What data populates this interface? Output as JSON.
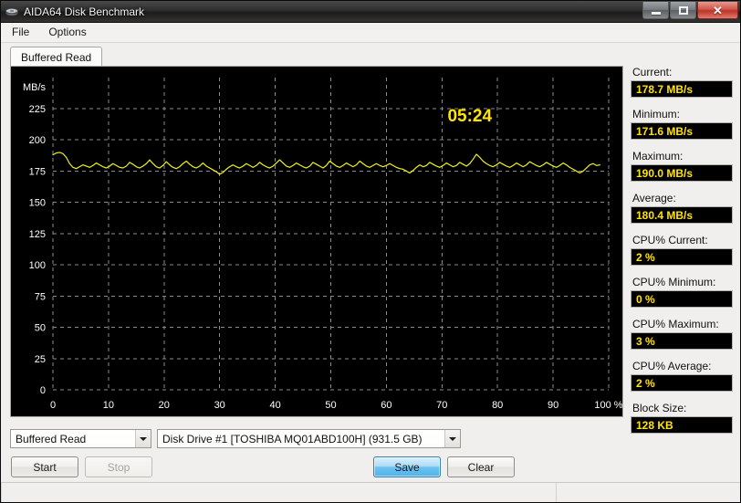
{
  "window": {
    "title": "AIDA64 Disk Benchmark",
    "icon": "disk-drive-icon",
    "minimize_label": "",
    "maximize_label": "",
    "close_label": "✕"
  },
  "menu": {
    "items": [
      {
        "label": "File"
      },
      {
        "label": "Options"
      }
    ]
  },
  "tabs": [
    {
      "label": "Buffered Read",
      "active": true
    }
  ],
  "chart_data": {
    "type": "line",
    "title": "",
    "xlabel": "%",
    "ylabel": "MB/s",
    "xlim": [
      0,
      100
    ],
    "ylim": [
      0,
      225
    ],
    "grid": true,
    "legend": "none",
    "xticks": [
      "0",
      "10",
      "20",
      "30",
      "40",
      "50",
      "60",
      "70",
      "80",
      "90",
      "100 %"
    ],
    "xtick_values": [
      0,
      10,
      20,
      30,
      40,
      50,
      60,
      70,
      80,
      90,
      100
    ],
    "yticks": [
      "0",
      "25",
      "50",
      "75",
      "100",
      "125",
      "150",
      "175",
      "200",
      "225"
    ],
    "ytick_values": [
      0,
      25,
      50,
      75,
      100,
      125,
      150,
      175,
      200,
      225
    ],
    "y_axis_caption": "MB/s",
    "series_color": "#f2f211",
    "timer_label": "05:24",
    "timer_color": "#ffe400",
    "background": "#000000",
    "gridline_color": "#8c8c8c",
    "series": [
      {
        "name": "Buffered Read",
        "x": [
          0.0,
          0.6,
          1.2,
          1.8,
          2.4,
          3.0,
          3.6,
          4.2,
          4.8,
          5.4,
          6.0,
          6.6,
          7.2,
          7.8,
          8.4,
          9.0,
          9.6,
          10.2,
          10.8,
          11.4,
          12.0,
          12.6,
          13.2,
          13.8,
          14.4,
          15.0,
          15.6,
          16.2,
          16.8,
          17.4,
          18.0,
          18.6,
          19.2,
          19.8,
          20.4,
          21.0,
          21.6,
          22.2,
          22.8,
          23.4,
          24.0,
          24.6,
          25.2,
          25.8,
          26.4,
          27.0,
          27.6,
          28.2,
          28.8,
          29.4,
          30.0,
          30.6,
          31.2,
          31.8,
          32.4,
          33.0,
          33.6,
          34.2,
          34.8,
          35.4,
          36.0,
          36.6,
          37.2,
          37.8,
          38.4,
          39.0,
          39.6,
          40.2,
          40.8,
          41.4,
          42.0,
          42.6,
          43.2,
          43.8,
          44.4,
          45.0,
          45.6,
          46.2,
          46.8,
          47.4,
          48.0,
          48.6,
          49.2,
          49.8,
          50.4,
          51.0,
          51.6,
          52.2,
          52.8,
          53.4,
          54.0,
          54.6,
          55.2,
          55.8,
          56.4,
          57.0,
          57.6,
          58.2,
          58.8,
          59.4,
          60.0,
          60.6,
          61.2,
          61.8,
          62.4,
          63.0,
          63.6,
          64.2,
          64.8,
          65.4,
          66.0,
          66.6,
          67.2,
          67.8,
          68.4,
          69.0,
          69.6,
          70.2,
          70.8,
          71.4,
          72.0,
          72.6,
          73.2,
          73.8,
          74.4,
          75.0,
          75.6,
          76.2,
          76.8,
          77.4,
          78.0,
          78.6,
          79.2,
          79.8,
          80.4,
          81.0,
          81.6,
          82.2,
          82.8,
          83.4,
          84.0,
          84.6,
          85.2,
          85.8,
          86.4,
          87.0,
          87.6,
          88.2,
          88.8,
          89.4,
          90.0,
          90.6,
          91.2,
          91.8,
          92.4,
          93.0,
          93.6,
          94.2,
          94.8,
          95.4,
          96.0,
          96.6,
          97.2,
          97.8,
          98.4,
          99.0,
          99.6,
          100.0
        ],
        "y": [
          188.0,
          189.5,
          190.0,
          189.0,
          186.0,
          181.0,
          178.0,
          177.0,
          178.5,
          180.0,
          179.0,
          178.0,
          179.5,
          181.5,
          180.0,
          178.5,
          177.5,
          179.0,
          181.0,
          179.5,
          178.0,
          177.5,
          179.0,
          182.0,
          180.5,
          178.5,
          177.5,
          179.0,
          181.0,
          184.0,
          181.0,
          178.5,
          177.5,
          179.5,
          182.5,
          180.0,
          178.0,
          177.0,
          178.5,
          181.0,
          183.0,
          180.5,
          178.5,
          177.5,
          179.0,
          181.5,
          179.0,
          177.5,
          176.0,
          174.5,
          172.5,
          174.0,
          176.5,
          178.5,
          180.0,
          178.5,
          177.5,
          179.0,
          181.0,
          179.5,
          178.0,
          179.5,
          182.0,
          180.0,
          178.5,
          177.5,
          179.0,
          181.5,
          184.0,
          181.5,
          179.0,
          178.0,
          179.5,
          181.5,
          180.0,
          178.5,
          177.5,
          179.0,
          182.0,
          180.5,
          179.0,
          177.5,
          179.5,
          183.0,
          181.0,
          179.0,
          178.0,
          179.5,
          181.5,
          180.0,
          178.5,
          180.0,
          183.0,
          181.0,
          179.0,
          178.0,
          179.5,
          181.0,
          179.5,
          178.5,
          179.5,
          181.0,
          179.5,
          178.0,
          177.0,
          176.5,
          175.0,
          173.5,
          175.5,
          178.0,
          180.0,
          178.5,
          179.5,
          182.0,
          180.5,
          179.0,
          178.0,
          179.5,
          181.5,
          180.0,
          178.5,
          179.5,
          182.0,
          180.5,
          179.0,
          181.0,
          184.5,
          188.5,
          186.0,
          183.0,
          181.0,
          179.5,
          178.5,
          180.0,
          182.0,
          180.5,
          179.0,
          178.0,
          179.5,
          181.5,
          180.0,
          178.5,
          180.0,
          182.5,
          181.0,
          179.5,
          178.5,
          180.0,
          182.0,
          180.5,
          179.0,
          178.0,
          179.5,
          181.5,
          180.0,
          178.0,
          176.5,
          175.0,
          173.5,
          175.0,
          177.5,
          180.0,
          181.0,
          179.5,
          180.0
        ]
      }
    ]
  },
  "stats": [
    {
      "label": "Current:",
      "value": "178.7 MB/s"
    },
    {
      "label": "Minimum:",
      "value": "171.6 MB/s"
    },
    {
      "label": "Maximum:",
      "value": "190.0 MB/s"
    },
    {
      "label": "Average:",
      "value": "180.4 MB/s"
    },
    {
      "label": "CPU% Current:",
      "value": "2 %"
    },
    {
      "label": "CPU% Minimum:",
      "value": "0 %"
    },
    {
      "label": "CPU% Maximum:",
      "value": "3 %"
    },
    {
      "label": "CPU% Average:",
      "value": "2 %"
    },
    {
      "label": "Block Size:",
      "value": "128 KB"
    }
  ],
  "controls": {
    "test_select": {
      "value": "Buffered Read",
      "options": [
        "Buffered Read"
      ]
    },
    "drive_select": {
      "value": "Disk Drive #1  [TOSHIBA MQ01ABD100H]  (931.5 GB)",
      "options": [
        "Disk Drive #1  [TOSHIBA MQ01ABD100H]  (931.5 GB)"
      ]
    },
    "start_button": "Start",
    "stop_button": "Stop",
    "save_button": "Save",
    "clear_button": "Clear"
  },
  "statusbar": {
    "left_text": "",
    "right_text": ""
  },
  "colors": {
    "accent": "#4fb3ea",
    "chart_series": "#f2f211",
    "value_text": "#ffe400",
    "panel_background": "#000000"
  }
}
